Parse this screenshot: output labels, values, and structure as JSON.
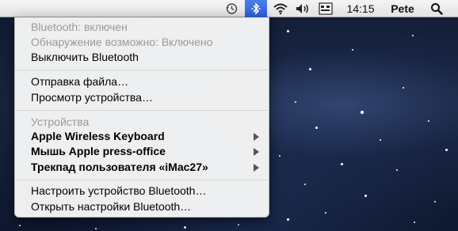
{
  "menubar": {
    "time": "14:15",
    "user": "Pete",
    "icons": [
      "time-machine-icon",
      "bluetooth-icon",
      "wifi-icon",
      "volume-icon",
      "keyboard-layout-icon",
      "spotlight-search-icon"
    ]
  },
  "bluetooth_menu": {
    "status": "Bluetooth: включен",
    "discoverable": "Обнаружение возможно: Включено",
    "turn_off": "Выключить Bluetooth",
    "send_file": "Отправка файла…",
    "browse_device": "Просмотр устройства…",
    "devices_header": "Устройства",
    "devices": [
      {
        "label": "Apple Wireless Keyboard"
      },
      {
        "label": "Мышь Apple press-office"
      },
      {
        "label": "Трекпад пользователя «iMac27»"
      }
    ],
    "setup_device": "Настроить устройство Bluetooth…",
    "open_preferences": "Открыть настройки Bluetooth…"
  },
  "colors": {
    "menubar_active": "#2a5ed4",
    "menu_background": "#f6f6f6",
    "disabled_text": "#9a9a9a"
  }
}
